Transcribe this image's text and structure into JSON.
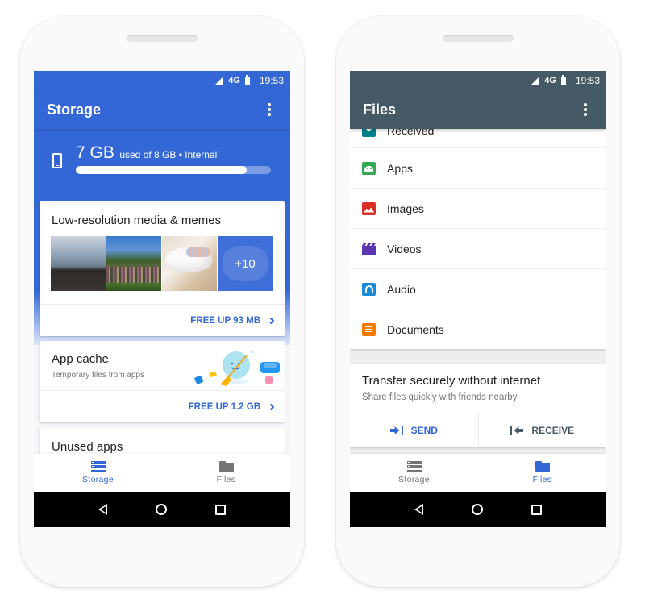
{
  "status_bar": {
    "network": "4G",
    "time": "19:53"
  },
  "storage_screen": {
    "title": "Storage",
    "usage": {
      "used": "7 GB",
      "detail": "used of 8 GB • Internal",
      "used_fraction": 0.875
    },
    "cards": {
      "media": {
        "title": "Low-resolution media & memes",
        "more_count": "+10",
        "action": "FREE UP 93 MB",
        "thumbnails": [
          "beach-photo",
          "crowd-in-park-photo",
          "cats-photo"
        ]
      },
      "cache": {
        "title": "App cache",
        "subtitle": "Temporary files from apps",
        "action": "FREE UP 1.2 GB"
      },
      "unused": {
        "title": "Unused apps"
      }
    },
    "bottom_nav": [
      {
        "label": "Storage",
        "icon": "storage-icon",
        "active": true
      },
      {
        "label": "Files",
        "icon": "folder-icon",
        "active": false
      }
    ]
  },
  "files_screen": {
    "title": "Files",
    "categories": [
      {
        "label": "Received",
        "icon": "received-icon",
        "color": "#00838f"
      },
      {
        "label": "Apps",
        "icon": "android-icon",
        "color": "#34a853"
      },
      {
        "label": "Images",
        "icon": "image-icon",
        "color": "#d93025"
      },
      {
        "label": "Videos",
        "icon": "video-icon",
        "color": "#5e35b1"
      },
      {
        "label": "Audio",
        "icon": "headphones-icon",
        "color": "#1a8ad8"
      },
      {
        "label": "Documents",
        "icon": "document-icon",
        "color": "#f57c00"
      }
    ],
    "transfer": {
      "title": "Transfer securely without internet",
      "subtitle": "Share files quickly with friends nearby",
      "send": "SEND",
      "receive": "RECEIVE"
    },
    "bottom_nav": [
      {
        "label": "Storage",
        "icon": "storage-icon",
        "active": false
      },
      {
        "label": "Files",
        "icon": "folder-icon",
        "active": true
      }
    ]
  },
  "colors": {
    "storage_primary": "#3367d6",
    "files_primary": "#455a64",
    "action_blue": "#3367d6"
  }
}
